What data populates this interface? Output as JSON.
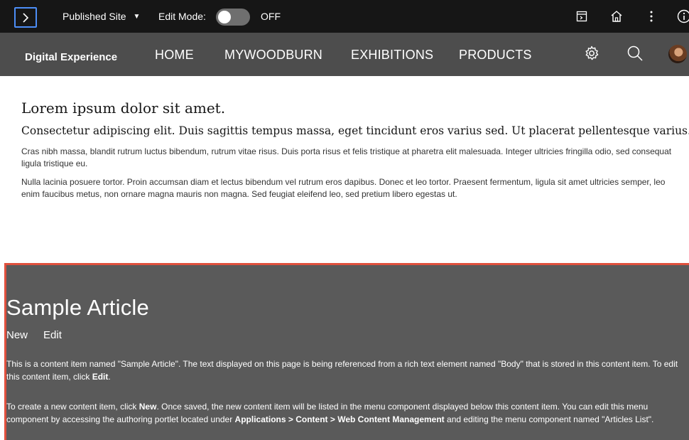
{
  "toolbar": {
    "site_select": "Published Site",
    "edit_mode_label": "Edit Mode:",
    "edit_mode_state": "OFF",
    "icons": [
      "chevron-right-icon",
      "caret-down-icon",
      "page-panel-icon",
      "home-icon",
      "more-vertical-icon",
      "info-icon"
    ]
  },
  "sitenav": {
    "brand": "Digital Experience",
    "items": [
      "HOME",
      "MYWOODBURN",
      "EXHIBITIONS",
      "PRODUCTS"
    ],
    "icons": [
      "gear-icon",
      "search-icon",
      "avatar"
    ]
  },
  "intro": {
    "title": "Lorem ipsum dolor sit amet.",
    "lead": "Consectetur adipiscing elit. Duis sagittis tempus massa, eget tincidunt eros varius sed. Ut placerat pellentesque varius.",
    "p1": "Cras nibh massa, blandit rutrum luctus bibendum, rutrum vitae risus. Duis porta risus et felis tristique at pharetra elit malesuada. Integer ultricies fringilla odio, sed consequat ligula tristique eu.",
    "p2": "Nulla lacinia posuere tortor. Proin accumsan diam et lectus bibendum vel rutrum eros dapibus. Donec et leo tortor. Praesent fermentum, ligula sit amet ultricies semper, leo enim faucibus metus, non ornare magna mauris non magna. Sed feugiat eleifend leo, sed pretium libero egestas ut."
  },
  "article": {
    "title": "Sample Article",
    "new_label": "New",
    "edit_label": "Edit",
    "p1_text": "This is a content item named \"Sample Article\". The text displayed on this page is being referenced from a rich text element named \"Body\" that is stored in this content item. To edit this content item, click ",
    "p1_bold": "Edit",
    "p1_end": ".",
    "p2_a": "To create a new content item, click ",
    "p2_new": "New",
    "p2_b": ". Once saved, the new content item will be listed in the menu component displayed below this content item. You can edit this menu component by accessing the authoring portlet located under ",
    "p2_path": "Applications > Content > Web Content Management",
    "p2_c": " and editing the menu component named \"Articles List\"."
  },
  "colors": {
    "toolbar_bg": "#161616",
    "nav_bg": "#4d4d4d",
    "article_bg": "#5a5a5a",
    "article_border": "#e0503d",
    "accent": "#4d8ef7"
  }
}
